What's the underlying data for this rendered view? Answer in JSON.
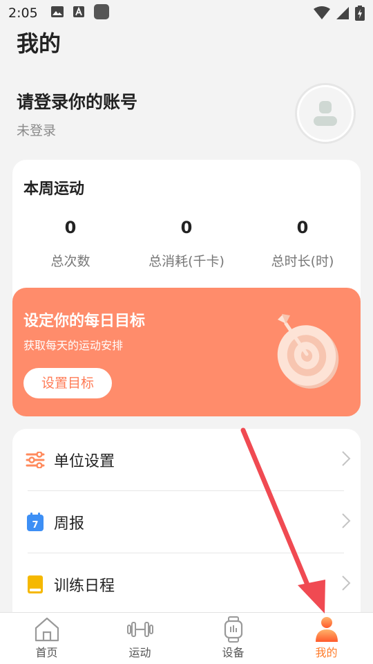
{
  "status_bar": {
    "time": "2:05"
  },
  "header": {
    "title": "我的"
  },
  "profile": {
    "login_title": "请登录你的账号",
    "login_status": "未登录"
  },
  "week_stats": {
    "title": "本周运动",
    "stats": [
      {
        "value": "0",
        "label": "总次数"
      },
      {
        "value": "0",
        "label": "总消耗(千卡)"
      },
      {
        "value": "0",
        "label": "总时长(时)"
      }
    ]
  },
  "goal_banner": {
    "title": "设定你的每日目标",
    "subtitle": "获取每天的运动安排",
    "button_label": "设置目标",
    "color": "#ff8c6b"
  },
  "settings": [
    {
      "icon": "sliders-icon",
      "label": "单位设置"
    },
    {
      "icon": "calendar-icon",
      "label": "周报",
      "badge": "7"
    },
    {
      "icon": "notebook-icon",
      "label": "训练日程"
    }
  ],
  "bottom_nav": [
    {
      "icon": "home-icon",
      "label": "首页",
      "active": false
    },
    {
      "icon": "dumbbell-icon",
      "label": "运动",
      "active": false
    },
    {
      "icon": "watch-icon",
      "label": "设备",
      "active": false
    },
    {
      "icon": "user-icon",
      "label": "我的",
      "active": true
    }
  ],
  "colors": {
    "accent": "#ff7c2b",
    "banner": "#ff8c6b",
    "arrow": "#f04a52"
  }
}
